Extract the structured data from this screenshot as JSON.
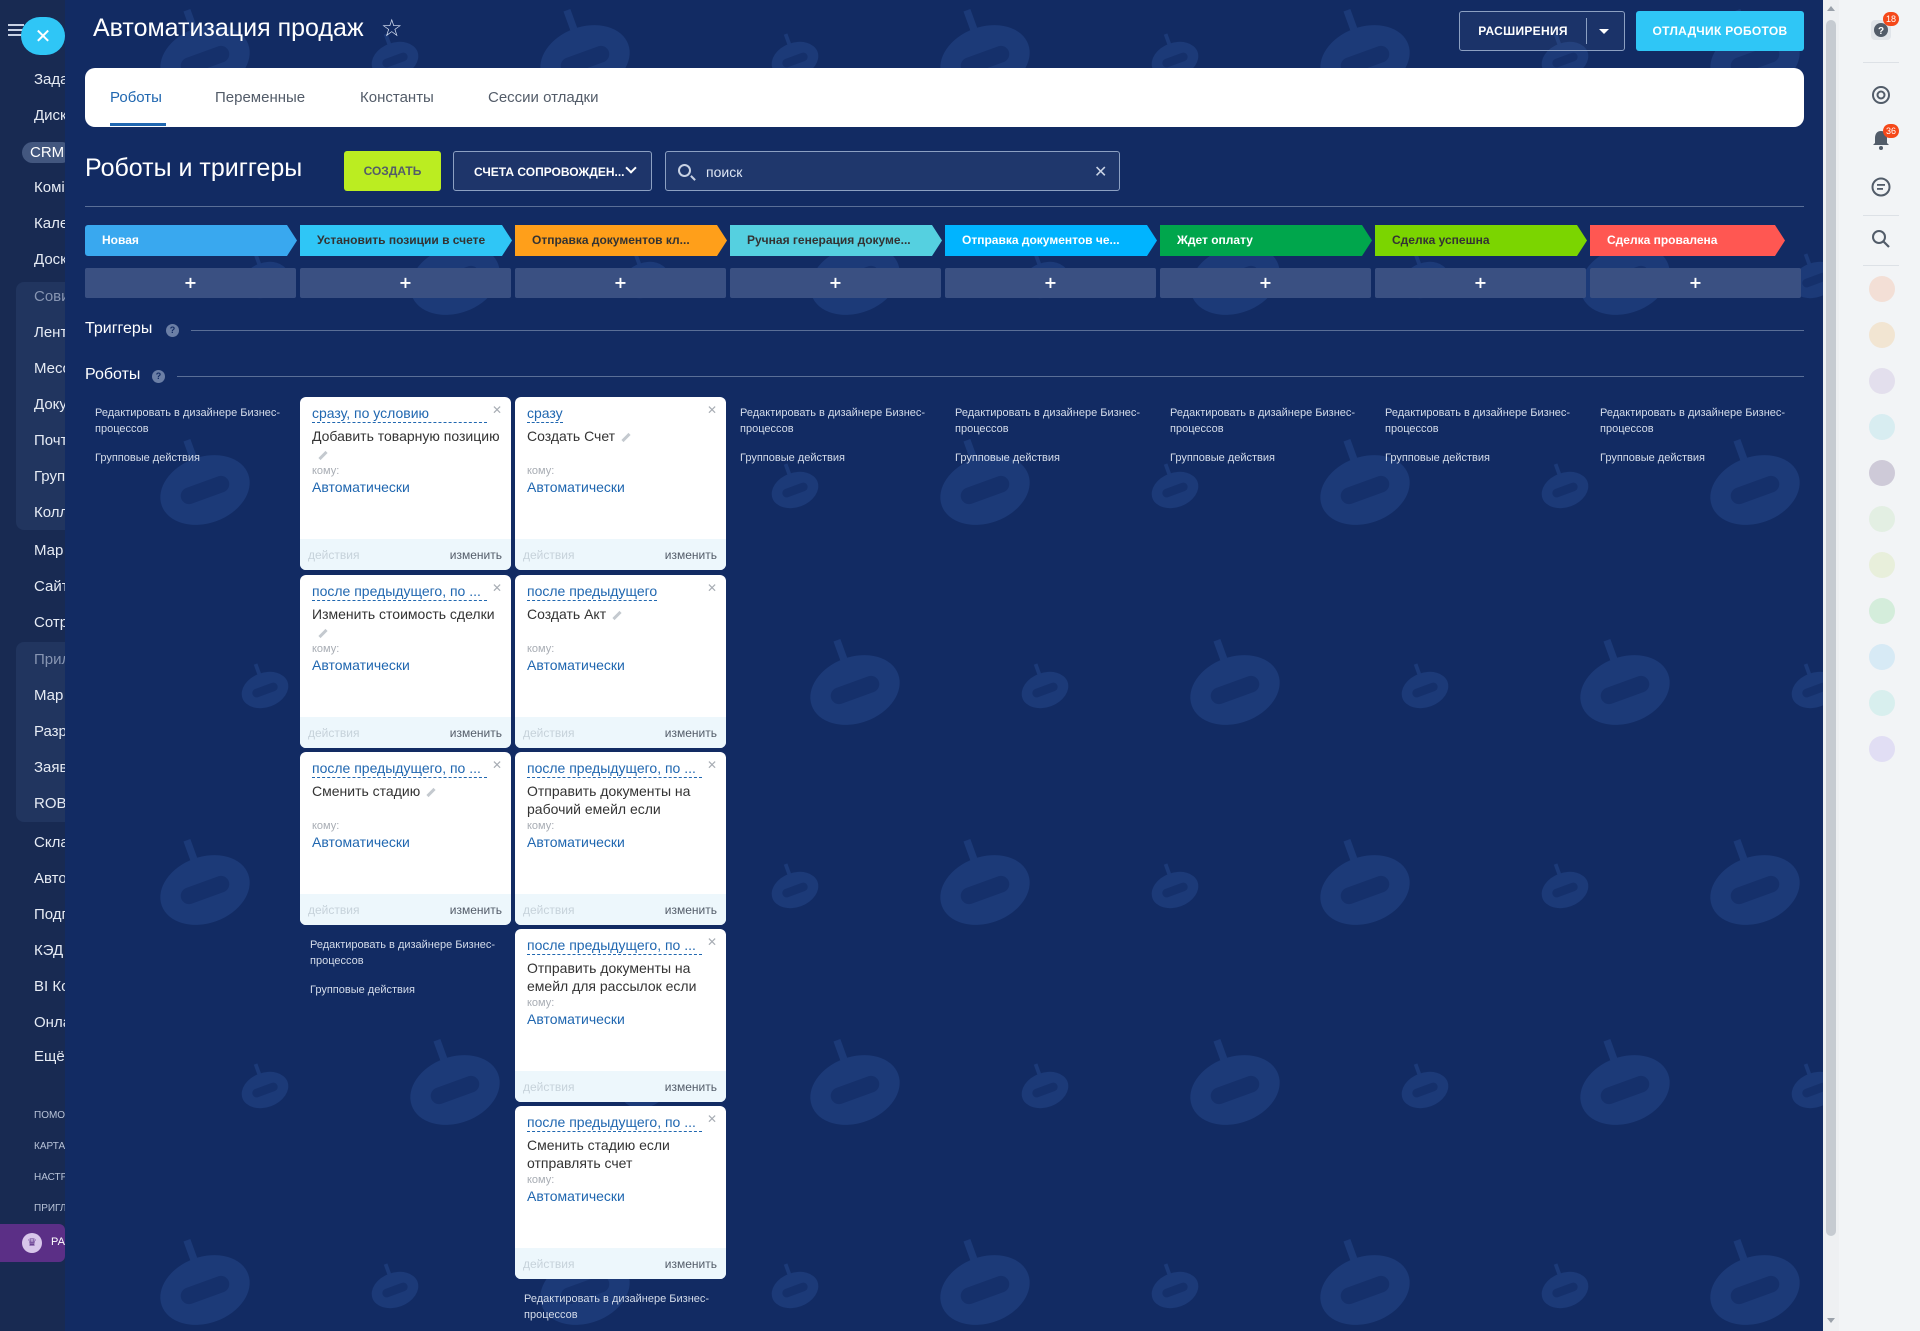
{
  "left_sidebar": {
    "items": [
      "Зада",
      "Диск",
      "CRM",
      "Комі",
      "Кале",
      "Доск",
      "Сови",
      "Лент",
      "Месс",
      "Доку",
      "Почт",
      "Груп",
      "Колл",
      "Мар",
      "Сайт",
      "Сотр",
      "Прил",
      "Мар",
      "Разр",
      "Заяв",
      "ROB",
      "Скла",
      "Авто",
      "Подг",
      "КЭД",
      "BI Ко",
      "Онла",
      "Ещё"
    ],
    "small_items": [
      "ПОМО",
      "КАРТА",
      "НАСТР",
      "ПРИГЛ"
    ],
    "plan_label": "РА"
  },
  "header": {
    "title": "Автоматизация продаж",
    "extensions_label": "РАСШИРЕНИЯ",
    "debugger_label": "ОТЛАДЧИК РОБОТОВ"
  },
  "tabs": [
    {
      "label": "Роботы",
      "active": true
    },
    {
      "label": "Переменные",
      "active": false
    },
    {
      "label": "Константы",
      "active": false
    },
    {
      "label": "Сессии отладки",
      "active": false
    }
  ],
  "toolbar": {
    "section_title": "Роботы и триггеры",
    "create_label": "СОЗДАТЬ",
    "filter_label": "СЧЕТА СОПРОВОЖДЕН...",
    "search_placeholder": "поиск"
  },
  "stages": [
    {
      "label": "Новая",
      "color": "#39a8ef",
      "text_color": "#ffffff"
    },
    {
      "label": "Установить позиции в счете",
      "color": "#2fc6f6",
      "text_color": "#333333"
    },
    {
      "label": "Отправка документов кл...",
      "color": "#ff9f1a",
      "text_color": "#333333"
    },
    {
      "label": "Ручная генерация докуме...",
      "color": "#55d0e0",
      "text_color": "#333333"
    },
    {
      "label": "Отправка документов че...",
      "color": "#00b4ff",
      "text_color": "#ffffff"
    },
    {
      "label": "Ждет оплату",
      "color": "#00a64c",
      "text_color": "#ffffff"
    },
    {
      "label": "Сделка успешна",
      "color": "#7bd500",
      "text_color": "#333333"
    },
    {
      "label": "Сделка провалена",
      "color": "#ff5752",
      "text_color": "#ffffff"
    }
  ],
  "add_stage_label": "+",
  "triggers_heading": "Триггеры",
  "robots_heading": "Роботы",
  "column_links": {
    "edit_designer": "Редактировать в дизайнере Бизнес-процессов",
    "group_actions": "Групповые действия"
  },
  "robot_labels": {
    "to": "кому:",
    "to_value": "Автоматически",
    "actions": "действия",
    "edit": "изменить"
  },
  "robots": {
    "col2": [
      {
        "condition": "сразу, по условию",
        "title": "Добавить товарную позицию"
      },
      {
        "condition": "после предыдущего, по ...",
        "title": "Изменить стоимость сделки"
      },
      {
        "condition": "после предыдущего, по ...",
        "title": "Сменить стадию"
      }
    ],
    "col3": [
      {
        "condition": "сразу",
        "title": "Создать Счет"
      },
      {
        "condition": "после предыдущего",
        "title": "Создать Акт"
      },
      {
        "condition": "после предыдущего, по ...",
        "title": "Отправить документы на рабочий емейл если"
      },
      {
        "condition": "после предыдущего, по ...",
        "title": "Отправить документы на емейл для рассылок если"
      },
      {
        "condition": "после предыдущего, по ...",
        "title": "Сменить стадию если отправлять счет"
      }
    ]
  },
  "right_panel": {
    "help_badge": "18",
    "notifications_badge": "36"
  }
}
